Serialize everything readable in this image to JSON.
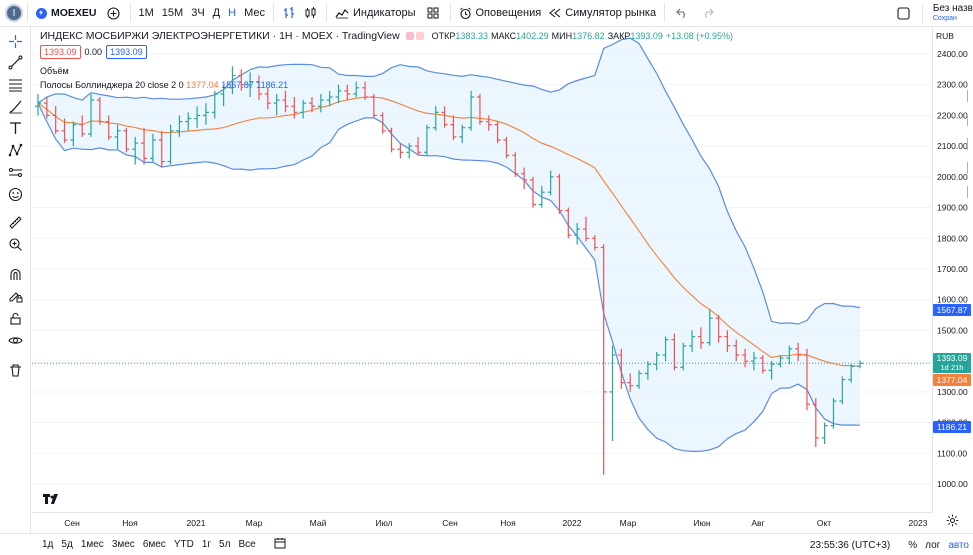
{
  "topbar": {
    "avatar": "I",
    "symbol": "MOEXEU",
    "intervals": [
      "1М",
      "15М",
      "3Ч",
      "Д",
      "Н",
      "Мес"
    ],
    "active_interval": "Н",
    "indicators": "Индикаторы",
    "alerts": "Оповещения",
    "replay": "Симулятор рынка",
    "save_title": "Без назв",
    "save_sub": "Сохран"
  },
  "legend": {
    "title": "ИНДЕКС МОСБИРЖИ ЭЛЕКТРОЭНЕРГЕТИКИ · 1Н · MOEX · TradingView",
    "ohlc": [
      {
        "label": "ОТКР",
        "value": "1383.33"
      },
      {
        "label": "МАКС",
        "value": "1402.29"
      },
      {
        "label": "МИН",
        "value": "1376.82"
      },
      {
        "label": "ЗАКР",
        "value": "1393.09"
      },
      {
        "label": "",
        "value": "+13.08 (+0.95%)"
      }
    ],
    "sell": "1393.09",
    "spread": "0.00",
    "buy": "1393.09",
    "volume": "Объём",
    "bb_label": "Полосы Боллинджера 20 close 2 0",
    "bb_basis": "1377.04",
    "bb_upper": "1567.87",
    "bb_lower": "1186.21"
  },
  "price_scale": {
    "currency": "RUB",
    "ticks": [
      "2400.00",
      "2300.00",
      "2200.00",
      "2100.00",
      "2000.00",
      "1900.00",
      "1800.00",
      "1700.00",
      "1600.00",
      "1500.00",
      "1400.00",
      "1300.00",
      "1200.00",
      "1100.00",
      "1000.00"
    ],
    "tag_upper": "1567.87",
    "tag_price": "1393.09",
    "tag_countdown": "1d 21h",
    "tag_basis": "1377.04",
    "tag_lower": "1186.21"
  },
  "time_scale": {
    "labels": [
      "Сен",
      "Ноя",
      "2021",
      "Мар",
      "Май",
      "Июл",
      "Сен",
      "Ноя",
      "2022",
      "Мар",
      "Июн",
      "Авг",
      "Окт",
      "2023"
    ]
  },
  "bottombar": {
    "ranges": [
      "1д",
      "5д",
      "1мес",
      "3мес",
      "6мес",
      "YTD",
      "1г",
      "5л",
      "Все"
    ],
    "clock": "23:55:36 (UTC+3)",
    "percent": "%",
    "log": "лог",
    "auto": "авто"
  },
  "colors": {
    "up": "#26a69a",
    "down": "#ef5350",
    "band": "#5b8ce0",
    "basis": "#f2813b",
    "band_fill": "#e3f2fd",
    "accent": "#2962ff"
  },
  "chart_data": {
    "type": "ohlc",
    "interval": "1Н",
    "price_range": [
      950,
      2480
    ],
    "currency": "RUB",
    "bars": [
      {
        "o": 2230,
        "h": 2270,
        "l": 2200,
        "c": 2240
      },
      {
        "o": 2240,
        "h": 2260,
        "l": 2190,
        "c": 2200
      },
      {
        "o": 2200,
        "h": 2230,
        "l": 2140,
        "c": 2150
      },
      {
        "o": 2150,
        "h": 2190,
        "l": 2110,
        "c": 2120
      },
      {
        "o": 2120,
        "h": 2180,
        "l": 2100,
        "c": 2170
      },
      {
        "o": 2170,
        "h": 2200,
        "l": 2130,
        "c": 2140
      },
      {
        "o": 2140,
        "h": 2270,
        "l": 2130,
        "c": 2250
      },
      {
        "o": 2250,
        "h": 2260,
        "l": 2170,
        "c": 2180
      },
      {
        "o": 2180,
        "h": 2200,
        "l": 2120,
        "c": 2130
      },
      {
        "o": 2130,
        "h": 2170,
        "l": 2090,
        "c": 2150
      },
      {
        "o": 2150,
        "h": 2160,
        "l": 2080,
        "c": 2090
      },
      {
        "o": 2090,
        "h": 2130,
        "l": 2040,
        "c": 2110
      },
      {
        "o": 2110,
        "h": 2160,
        "l": 2040,
        "c": 2060
      },
      {
        "o": 2060,
        "h": 2140,
        "l": 2050,
        "c": 2120
      },
      {
        "o": 2120,
        "h": 2150,
        "l": 2030,
        "c": 2050
      },
      {
        "o": 2050,
        "h": 2170,
        "l": 2040,
        "c": 2150
      },
      {
        "o": 2150,
        "h": 2200,
        "l": 2130,
        "c": 2180
      },
      {
        "o": 2180,
        "h": 2210,
        "l": 2150,
        "c": 2190
      },
      {
        "o": 2190,
        "h": 2230,
        "l": 2160,
        "c": 2200
      },
      {
        "o": 2200,
        "h": 2240,
        "l": 2170,
        "c": 2210
      },
      {
        "o": 2210,
        "h": 2280,
        "l": 2190,
        "c": 2270
      },
      {
        "o": 2270,
        "h": 2300,
        "l": 2230,
        "c": 2290
      },
      {
        "o": 2290,
        "h": 2360,
        "l": 2270,
        "c": 2330
      },
      {
        "o": 2330,
        "h": 2350,
        "l": 2280,
        "c": 2300
      },
      {
        "o": 2300,
        "h": 2340,
        "l": 2260,
        "c": 2310
      },
      {
        "o": 2310,
        "h": 2330,
        "l": 2250,
        "c": 2270
      },
      {
        "o": 2270,
        "h": 2290,
        "l": 2220,
        "c": 2240
      },
      {
        "o": 2240,
        "h": 2270,
        "l": 2200,
        "c": 2250
      },
      {
        "o": 2250,
        "h": 2280,
        "l": 2210,
        "c": 2230
      },
      {
        "o": 2230,
        "h": 2260,
        "l": 2190,
        "c": 2210
      },
      {
        "o": 2210,
        "h": 2250,
        "l": 2190,
        "c": 2240
      },
      {
        "o": 2240,
        "h": 2260,
        "l": 2210,
        "c": 2230
      },
      {
        "o": 2230,
        "h": 2270,
        "l": 2210,
        "c": 2250
      },
      {
        "o": 2250,
        "h": 2280,
        "l": 2230,
        "c": 2260
      },
      {
        "o": 2260,
        "h": 2300,
        "l": 2240,
        "c": 2280
      },
      {
        "o": 2280,
        "h": 2300,
        "l": 2250,
        "c": 2270
      },
      {
        "o": 2270,
        "h": 2310,
        "l": 2260,
        "c": 2290
      },
      {
        "o": 2290,
        "h": 2310,
        "l": 2250,
        "c": 2260
      },
      {
        "o": 2260,
        "h": 2270,
        "l": 2190,
        "c": 2200
      },
      {
        "o": 2200,
        "h": 2210,
        "l": 2140,
        "c": 2150
      },
      {
        "o": 2150,
        "h": 2160,
        "l": 2080,
        "c": 2090
      },
      {
        "o": 2090,
        "h": 2110,
        "l": 2060,
        "c": 2080
      },
      {
        "o": 2080,
        "h": 2110,
        "l": 2060,
        "c": 2100
      },
      {
        "o": 2100,
        "h": 2130,
        "l": 2070,
        "c": 2080
      },
      {
        "o": 2080,
        "h": 2170,
        "l": 2070,
        "c": 2160
      },
      {
        "o": 2160,
        "h": 2230,
        "l": 2150,
        "c": 2210
      },
      {
        "o": 2210,
        "h": 2230,
        "l": 2160,
        "c": 2170
      },
      {
        "o": 2170,
        "h": 2200,
        "l": 2120,
        "c": 2130
      },
      {
        "o": 2130,
        "h": 2170,
        "l": 2110,
        "c": 2160
      },
      {
        "o": 2160,
        "h": 2280,
        "l": 2150,
        "c": 2260
      },
      {
        "o": 2260,
        "h": 2270,
        "l": 2170,
        "c": 2180
      },
      {
        "o": 2180,
        "h": 2200,
        "l": 2150,
        "c": 2170
      },
      {
        "o": 2170,
        "h": 2180,
        "l": 2110,
        "c": 2120
      },
      {
        "o": 2120,
        "h": 2130,
        "l": 2060,
        "c": 2070
      },
      {
        "o": 2070,
        "h": 2080,
        "l": 2000,
        "c": 2010
      },
      {
        "o": 2010,
        "h": 2030,
        "l": 1960,
        "c": 1990
      },
      {
        "o": 1990,
        "h": 2000,
        "l": 1900,
        "c": 1910
      },
      {
        "o": 1910,
        "h": 1970,
        "l": 1900,
        "c": 1950
      },
      {
        "o": 1950,
        "h": 2020,
        "l": 1940,
        "c": 2000
      },
      {
        "o": 2000,
        "h": 2010,
        "l": 1880,
        "c": 1890
      },
      {
        "o": 1890,
        "h": 1900,
        "l": 1800,
        "c": 1810
      },
      {
        "o": 1810,
        "h": 1850,
        "l": 1780,
        "c": 1830
      },
      {
        "o": 1830,
        "h": 1870,
        "l": 1790,
        "c": 1800
      },
      {
        "o": 1800,
        "h": 1810,
        "l": 1760,
        "c": 1770
      },
      {
        "o": 1770,
        "h": 1780,
        "l": 1030,
        "c": 1300
      },
      {
        "o": 1300,
        "h": 1450,
        "l": 1140,
        "c": 1420
      },
      {
        "o": 1420,
        "h": 1440,
        "l": 1310,
        "c": 1330
      },
      {
        "o": 1330,
        "h": 1360,
        "l": 1300,
        "c": 1320
      },
      {
        "o": 1320,
        "h": 1370,
        "l": 1310,
        "c": 1360
      },
      {
        "o": 1360,
        "h": 1400,
        "l": 1340,
        "c": 1390
      },
      {
        "o": 1390,
        "h": 1430,
        "l": 1370,
        "c": 1420
      },
      {
        "o": 1420,
        "h": 1480,
        "l": 1400,
        "c": 1470
      },
      {
        "o": 1470,
        "h": 1490,
        "l": 1370,
        "c": 1380
      },
      {
        "o": 1380,
        "h": 1460,
        "l": 1370,
        "c": 1450
      },
      {
        "o": 1450,
        "h": 1500,
        "l": 1430,
        "c": 1480
      },
      {
        "o": 1480,
        "h": 1510,
        "l": 1440,
        "c": 1460
      },
      {
        "o": 1460,
        "h": 1570,
        "l": 1450,
        "c": 1540
      },
      {
        "o": 1540,
        "h": 1550,
        "l": 1460,
        "c": 1480
      },
      {
        "o": 1480,
        "h": 1500,
        "l": 1430,
        "c": 1450
      },
      {
        "o": 1450,
        "h": 1470,
        "l": 1400,
        "c": 1420
      },
      {
        "o": 1420,
        "h": 1440,
        "l": 1380,
        "c": 1400
      },
      {
        "o": 1400,
        "h": 1430,
        "l": 1370,
        "c": 1410
      },
      {
        "o": 1410,
        "h": 1420,
        "l": 1360,
        "c": 1370
      },
      {
        "o": 1370,
        "h": 1400,
        "l": 1340,
        "c": 1390
      },
      {
        "o": 1390,
        "h": 1420,
        "l": 1380,
        "c": 1410
      },
      {
        "o": 1410,
        "h": 1450,
        "l": 1390,
        "c": 1440
      },
      {
        "o": 1440,
        "h": 1460,
        "l": 1400,
        "c": 1420
      },
      {
        "o": 1420,
        "h": 1440,
        "l": 1240,
        "c": 1260
      },
      {
        "o": 1260,
        "h": 1280,
        "l": 1120,
        "c": 1150
      },
      {
        "o": 1150,
        "h": 1200,
        "l": 1130,
        "c": 1190
      },
      {
        "o": 1190,
        "h": 1280,
        "l": 1180,
        "c": 1270
      },
      {
        "o": 1270,
        "h": 1350,
        "l": 1260,
        "c": 1340
      },
      {
        "o": 1340,
        "h": 1390,
        "l": 1330,
        "c": 1383
      },
      {
        "o": 1383.33,
        "h": 1402.29,
        "l": 1376.82,
        "c": 1393.09
      }
    ]
  }
}
